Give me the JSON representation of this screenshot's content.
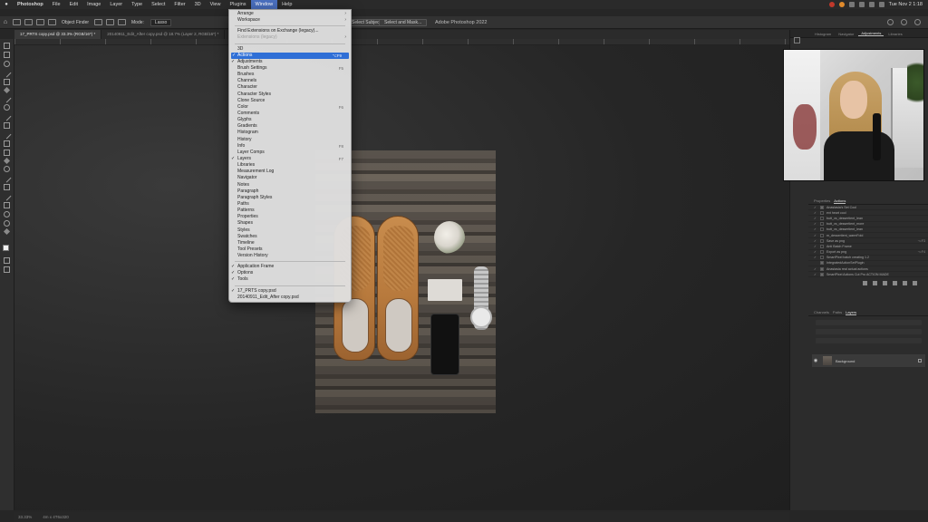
{
  "mac_menu": {
    "items": [
      "Photoshop",
      "File",
      "Edit",
      "Image",
      "Layer",
      "Type",
      "Select",
      "Filter",
      "3D",
      "View",
      "Plugins",
      "Window",
      "Help"
    ],
    "active_index": 11,
    "clock": "Tue Nov 2  1:18"
  },
  "options_bar": {
    "object_finder_label": "Object Finder",
    "mode_label": "Mode:",
    "mode_value": "Lasso",
    "subject_button": "Select Subject",
    "select_mask_button": "Select and Mask...",
    "app_title": "Adobe Photoshop 2022"
  },
  "tabs": [
    {
      "label": "17_PRTS copy.psd @ 33.3% (RGB/16*) *",
      "active": true
    },
    {
      "label": "20140911_Edit_After copy.psd @ 18.7% (Layer 2, RGB/16*) *",
      "active": false
    }
  ],
  "window_menu": {
    "items": [
      {
        "label": "Arrange",
        "submenu": true
      },
      {
        "label": "Workspace",
        "submenu": true
      },
      {
        "sep": true
      },
      {
        "label": "Find Extensions on Exchange (legacy)..."
      },
      {
        "label": "Extensions (legacy)",
        "disabled": true,
        "submenu": true
      },
      {
        "sep": true
      },
      {
        "label": "3D"
      },
      {
        "label": "Actions",
        "checked": true,
        "highlight": true,
        "shortcut": "⌥F9"
      },
      {
        "label": "Adjustments",
        "checked": true
      },
      {
        "label": "Brush Settings",
        "shortcut": "F5"
      },
      {
        "label": "Brushes"
      },
      {
        "label": "Channels"
      },
      {
        "label": "Character"
      },
      {
        "label": "Character Styles"
      },
      {
        "label": "Clone Source"
      },
      {
        "label": "Color",
        "shortcut": "F6"
      },
      {
        "label": "Comments"
      },
      {
        "label": "Glyphs"
      },
      {
        "label": "Gradients"
      },
      {
        "label": "Histogram"
      },
      {
        "label": "History"
      },
      {
        "label": "Info",
        "shortcut": "F8"
      },
      {
        "label": "Layer Comps"
      },
      {
        "label": "Layers",
        "checked": true,
        "shortcut": "F7"
      },
      {
        "label": "Libraries"
      },
      {
        "label": "Measurement Log"
      },
      {
        "label": "Navigator"
      },
      {
        "label": "Notes"
      },
      {
        "label": "Paragraph"
      },
      {
        "label": "Paragraph Styles"
      },
      {
        "label": "Paths"
      },
      {
        "label": "Patterns"
      },
      {
        "label": "Properties"
      },
      {
        "label": "Shapes"
      },
      {
        "label": "Styles"
      },
      {
        "label": "Swatches"
      },
      {
        "label": "Timeline"
      },
      {
        "label": "Tool Presets"
      },
      {
        "label": "Version History"
      },
      {
        "sep": true
      },
      {
        "label": "Application Frame",
        "checked": true
      },
      {
        "label": "Options",
        "checked": true
      },
      {
        "label": "Tools",
        "checked": true
      },
      {
        "sep": true
      },
      {
        "label": "17_PRTS copy.psd",
        "checked": true
      },
      {
        "label": "20140911_Edit_After copy.psd"
      }
    ]
  },
  "right_panel": {
    "top_tabs": [
      "Histogram",
      "Navigator",
      "Adjustments",
      "Libraries"
    ],
    "top_active": 2,
    "actions_tabs": [
      "Properties",
      "Actions"
    ],
    "actions_active": 1,
    "actions": [
      {
        "name": "Anastasia's Set Cool",
        "checked": true,
        "folder": true,
        "key": ""
      },
      {
        "name": "ext heart cool",
        "checked": true,
        "folder": false,
        "key": ""
      },
      {
        "name": "butt_vs_dessertient_lean",
        "checked": true,
        "folder": false,
        "key": ""
      },
      {
        "name": "butt_vs_dessertient_more",
        "checked": true,
        "folder": false,
        "key": ""
      },
      {
        "name": "butt_vs_dessertient_lean",
        "checked": true,
        "folder": false,
        "key": ""
      },
      {
        "name": "m_dessertient_warmFold",
        "checked": true,
        "folder": false,
        "key": ""
      },
      {
        "name": "Save as png",
        "checked": true,
        "folder": false,
        "key": "⌥F3"
      },
      {
        "name": "Anti Batch Frame",
        "checked": true,
        "folder": false,
        "key": ""
      },
      {
        "name": "Export as png",
        "checked": true,
        "folder": false,
        "key": "⌥F4"
      },
      {
        "name": "SmartPixel batch creating 1.2",
        "checked": true,
        "folder": false,
        "key": ""
      },
      {
        "name": "IntegratedActionSetPlugin",
        "checked": false,
        "folder": true,
        "key": ""
      },
      {
        "name": "Anastasia real actual actions",
        "checked": true,
        "folder": true,
        "key": ""
      },
      {
        "name": "SmartPixel Actions Cut Pro ACTION MADE",
        "checked": true,
        "folder": true,
        "key": ""
      }
    ],
    "layers_tabs": [
      "Channels",
      "Paths",
      "Layers"
    ],
    "layers_active": 2,
    "layer_name": "Background"
  },
  "status": {
    "zoom": "33.33%",
    "doc_info": "4m x 4T6x320"
  },
  "colors": {
    "highlight": "#2f6fd6",
    "menu_bg": "#e0e0e0",
    "canvas_bg": "#262626"
  }
}
